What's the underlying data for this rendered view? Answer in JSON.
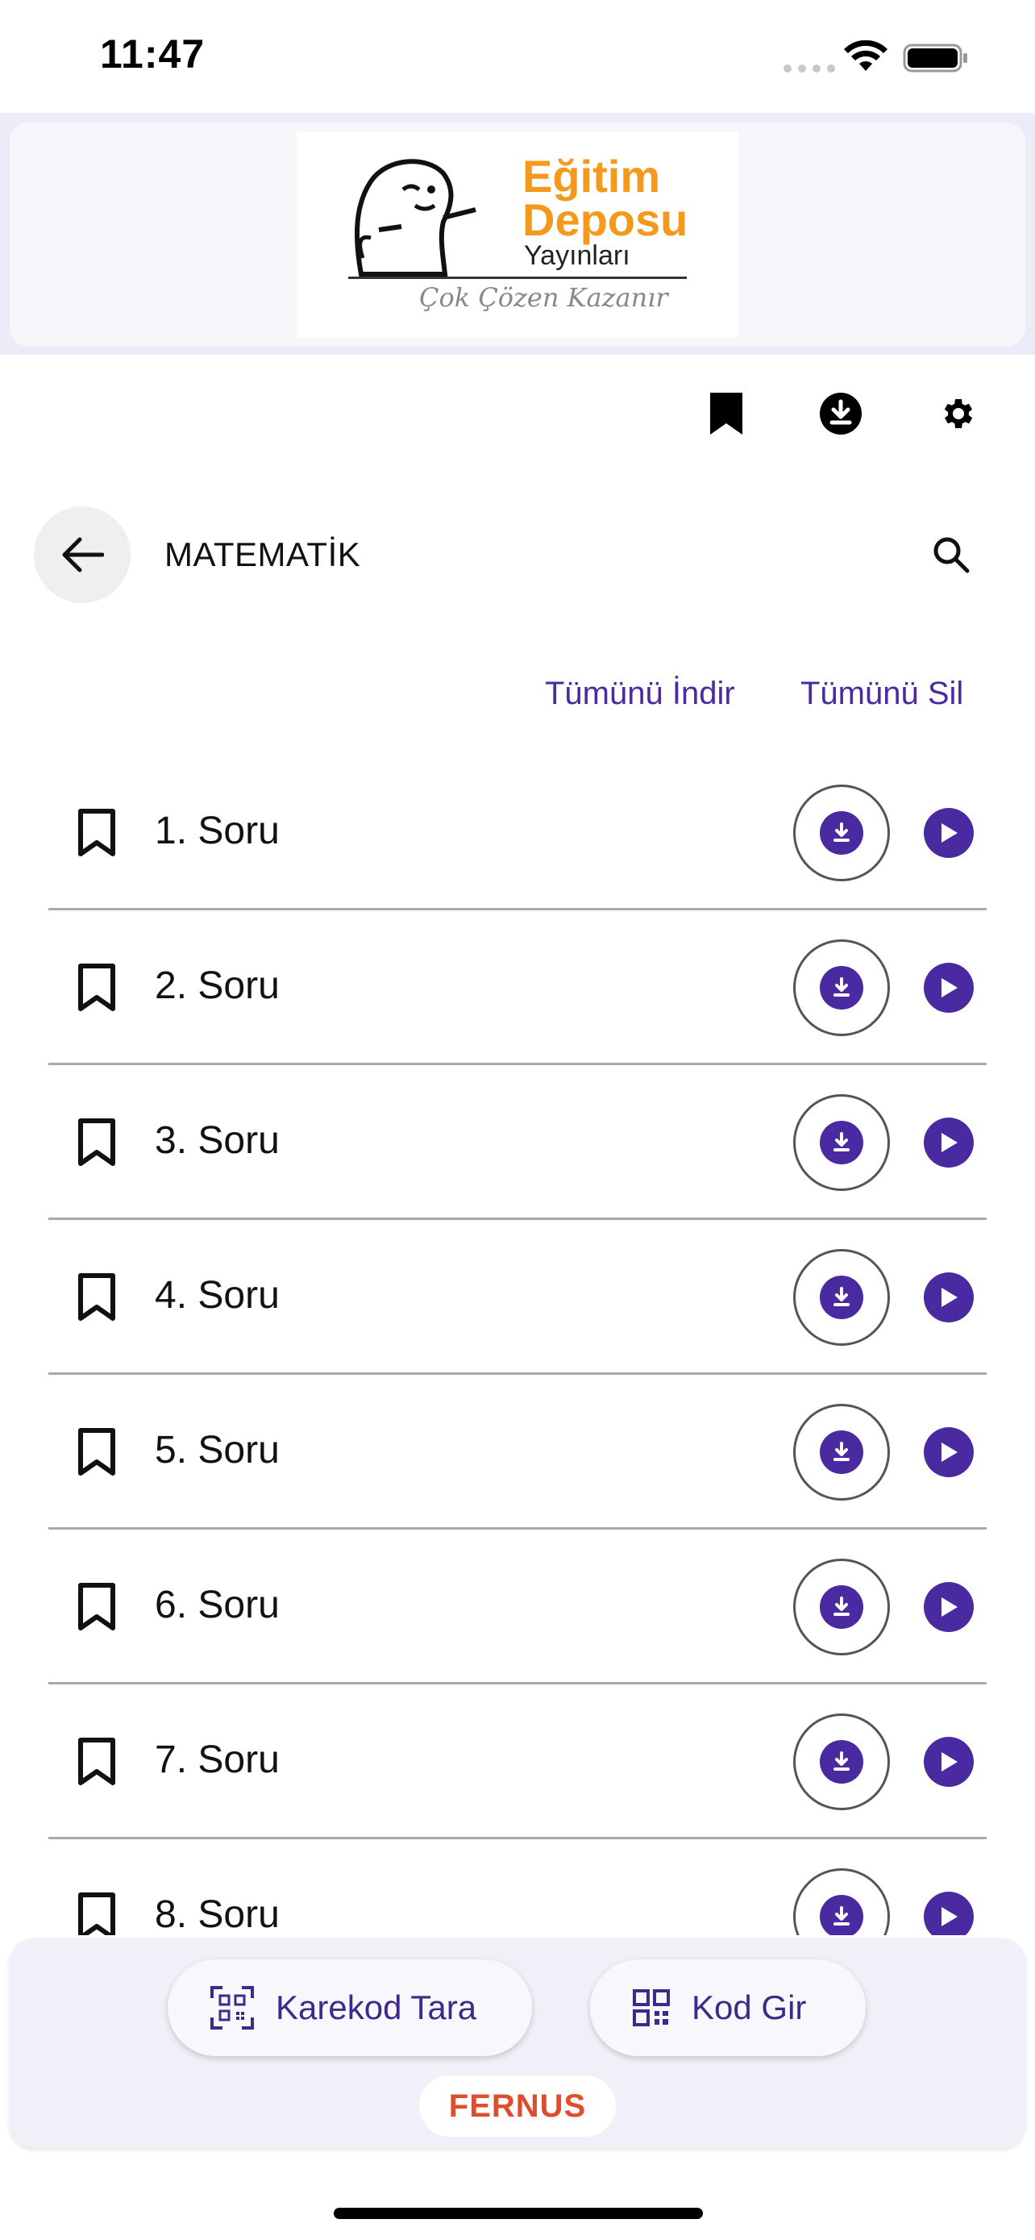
{
  "status_bar": {
    "time": "11:47"
  },
  "header": {
    "logo": {
      "line1": "Eğitim",
      "line2": "Deposu",
      "line3": "Yayınları",
      "tagline": "Çok Çözen Kazanır"
    }
  },
  "toolbar": {
    "icons": [
      "bookmark-icon",
      "download-icon",
      "settings-icon"
    ]
  },
  "page": {
    "title": "MATEMATİK",
    "download_all": "Tümünü İndir",
    "delete_all": "Tümünü Sil"
  },
  "questions": [
    {
      "label": "1. Soru"
    },
    {
      "label": "2. Soru"
    },
    {
      "label": "3. Soru"
    },
    {
      "label": "4. Soru"
    },
    {
      "label": "5. Soru"
    },
    {
      "label": "6. Soru"
    },
    {
      "label": "7. Soru"
    },
    {
      "label": "8. Soru"
    }
  ],
  "bottom_bar": {
    "scan_label": "Karekod Tara",
    "code_label": "Kod Gir",
    "brand": "FERNUS"
  },
  "colors": {
    "accent": "#4a2aa0",
    "logo_orange": "#f39a1e",
    "brand_red": "#e14d2a"
  }
}
